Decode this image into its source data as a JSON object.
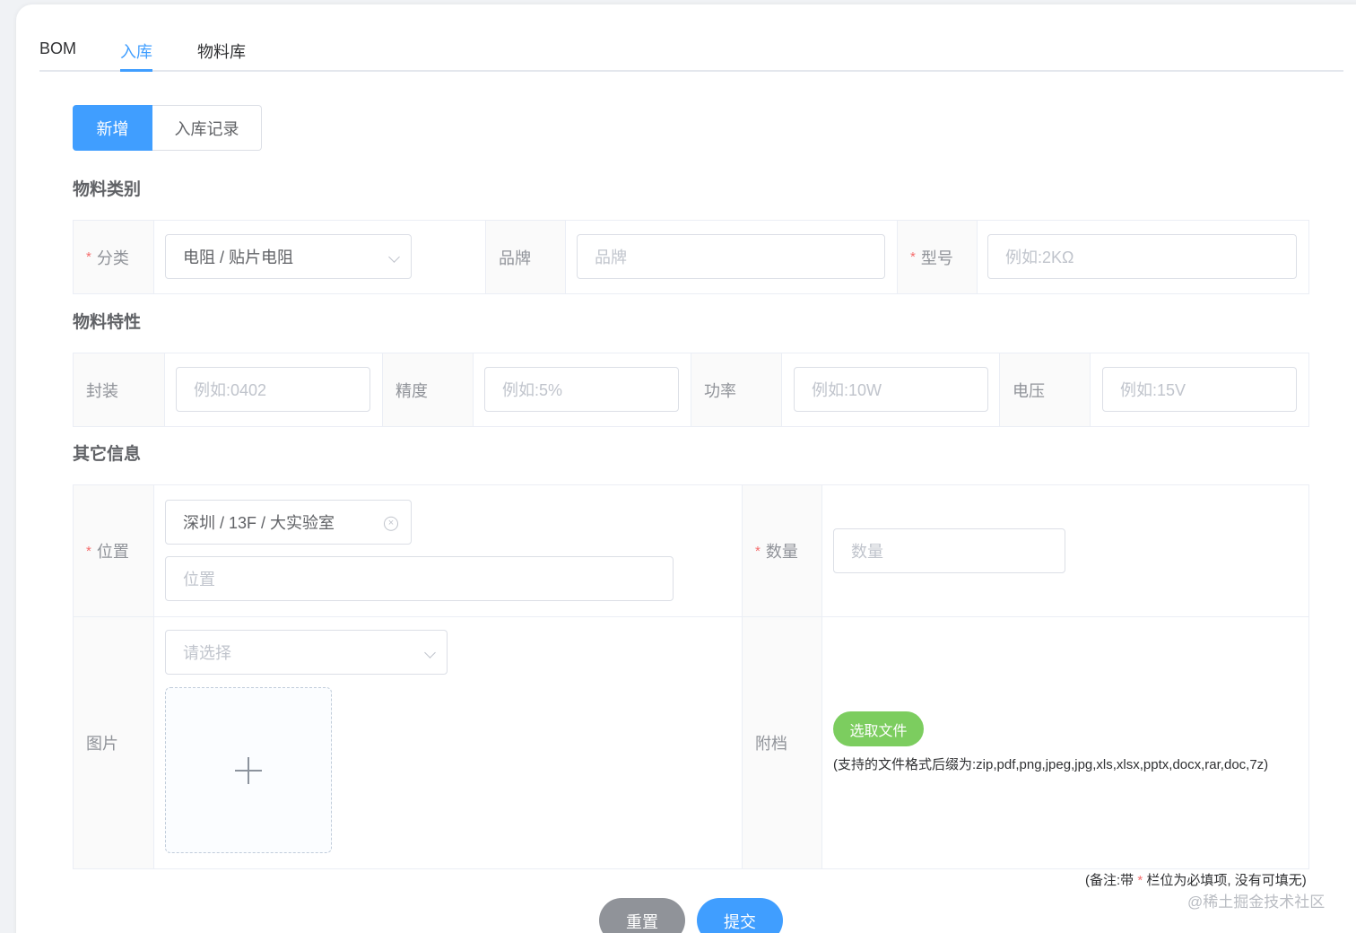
{
  "tabs": [
    {
      "label": "BOM"
    },
    {
      "label": "入库"
    },
    {
      "label": "物料库"
    }
  ],
  "sub_buttons": {
    "add": "新增",
    "records": "入库记录"
  },
  "sections": {
    "category": "物料类别",
    "properties": "物料特性",
    "other": "其它信息"
  },
  "category": {
    "class_label": "分类",
    "class_value": "电阻 / 贴片电阻",
    "brand_label": "品牌",
    "brand_placeholder": "品牌",
    "model_label": "型号",
    "model_placeholder": "例如:2KΩ",
    "required_mark": "*"
  },
  "properties": {
    "package_label": "封装",
    "package_placeholder": "例如:0402",
    "precision_label": "精度",
    "precision_placeholder": "例如:5%",
    "power_label": "功率",
    "power_placeholder": "例如:10W",
    "voltage_label": "电压",
    "voltage_placeholder": "例如:15V"
  },
  "other": {
    "location_label": "位置",
    "location_value": "深圳 / 13F / 大实验室",
    "location_placeholder": "位置",
    "quantity_label": "数量",
    "quantity_placeholder": "数量",
    "image_label": "图片",
    "image_select_placeholder": "请选择",
    "attachment_label": "附档",
    "pick_file_button": "选取文件",
    "file_hint": "(支持的文件格式后缀为:zip,pdf,png,jpeg,jpg,xls,xlsx,pptx,docx,rar,doc,7z)"
  },
  "note": {
    "prefix": "(备注:带 ",
    "star": "*",
    "suffix": " 栏位为必填项, 没有可填无)"
  },
  "actions": {
    "reset": "重置",
    "submit": "提交"
  },
  "watermark": "@稀土掘金技术社区",
  "colors": {
    "primary": "#409eff",
    "success": "#7ccd5f",
    "info": "#909399",
    "danger": "#f56c6c"
  }
}
